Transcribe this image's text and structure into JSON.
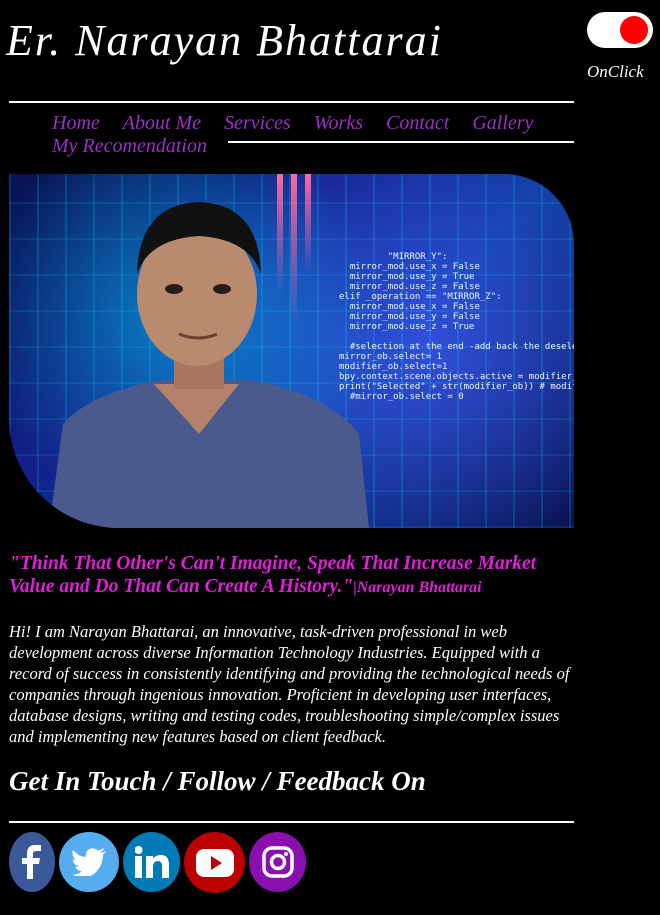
{
  "header": {
    "logo_text": "Er. Narayan Bhattarai",
    "toggle_label": "OnClick",
    "toggle_state": "on"
  },
  "nav": {
    "items": [
      {
        "label": "Home"
      },
      {
        "label": "About Me"
      },
      {
        "label": "Services"
      },
      {
        "label": "Works"
      },
      {
        "label": "Contact"
      },
      {
        "label": "Gallery"
      },
      {
        "label": "My Recomendation"
      }
    ]
  },
  "hero": {
    "code_lines": [
      "         \"MIRROR_Y\":",
      "  mirror_mod.use_x = False",
      "  mirror_mod.use_y = True",
      "  mirror_mod.use_z = False",
      "elif _operation == \"MIRROR_Z\":",
      "  mirror_mod.use_x = False",
      "  mirror_mod.use_y = False",
      "  mirror_mod.use_z = True",
      "",
      "  #selection at the end -add back the deselecte",
      "mirror_ob.select= 1",
      "modifier_ob.select=1",
      "bpy.context.scene.objects.active = modifier_ob",
      "print(\"Selected\" + str(modifier_ob)) # modifier o",
      "  #mirror_ob.select = 0"
    ]
  },
  "quote": {
    "text": "\"Think That Other's Can't Imagine, Speak That Increase Market Value and Do That Can Create A History.\"",
    "author": "|Narayan Bhattarai"
  },
  "bio": {
    "text": "Hi! I am Narayan Bhattarai, an innovative, task-driven professional in web development across diverse Information Technology Industries. Equipped with a record of success in consistently identifying and providing the technological needs of companies through ingenious innovation. Proficient in developing user interfaces, database designs, writing and testing codes, troubleshooting simple/complex issues and implementing new features based on client feedback."
  },
  "contact": {
    "heading": "Get In Touch / Follow / Feedback On"
  },
  "socials": [
    {
      "icon": "facebook-icon",
      "color": "#3b5998"
    },
    {
      "icon": "twitter-icon",
      "color": "#55acee"
    },
    {
      "icon": "linkedin-icon",
      "color": "#007bb5"
    },
    {
      "icon": "youtube-icon",
      "color": "#bb0000"
    },
    {
      "icon": "instagram-icon",
      "color": "#8a0fb0"
    }
  ],
  "colors": {
    "nav": "#9b30c8",
    "quote": "#e01fd8",
    "toggle_knob": "#ff0000"
  }
}
